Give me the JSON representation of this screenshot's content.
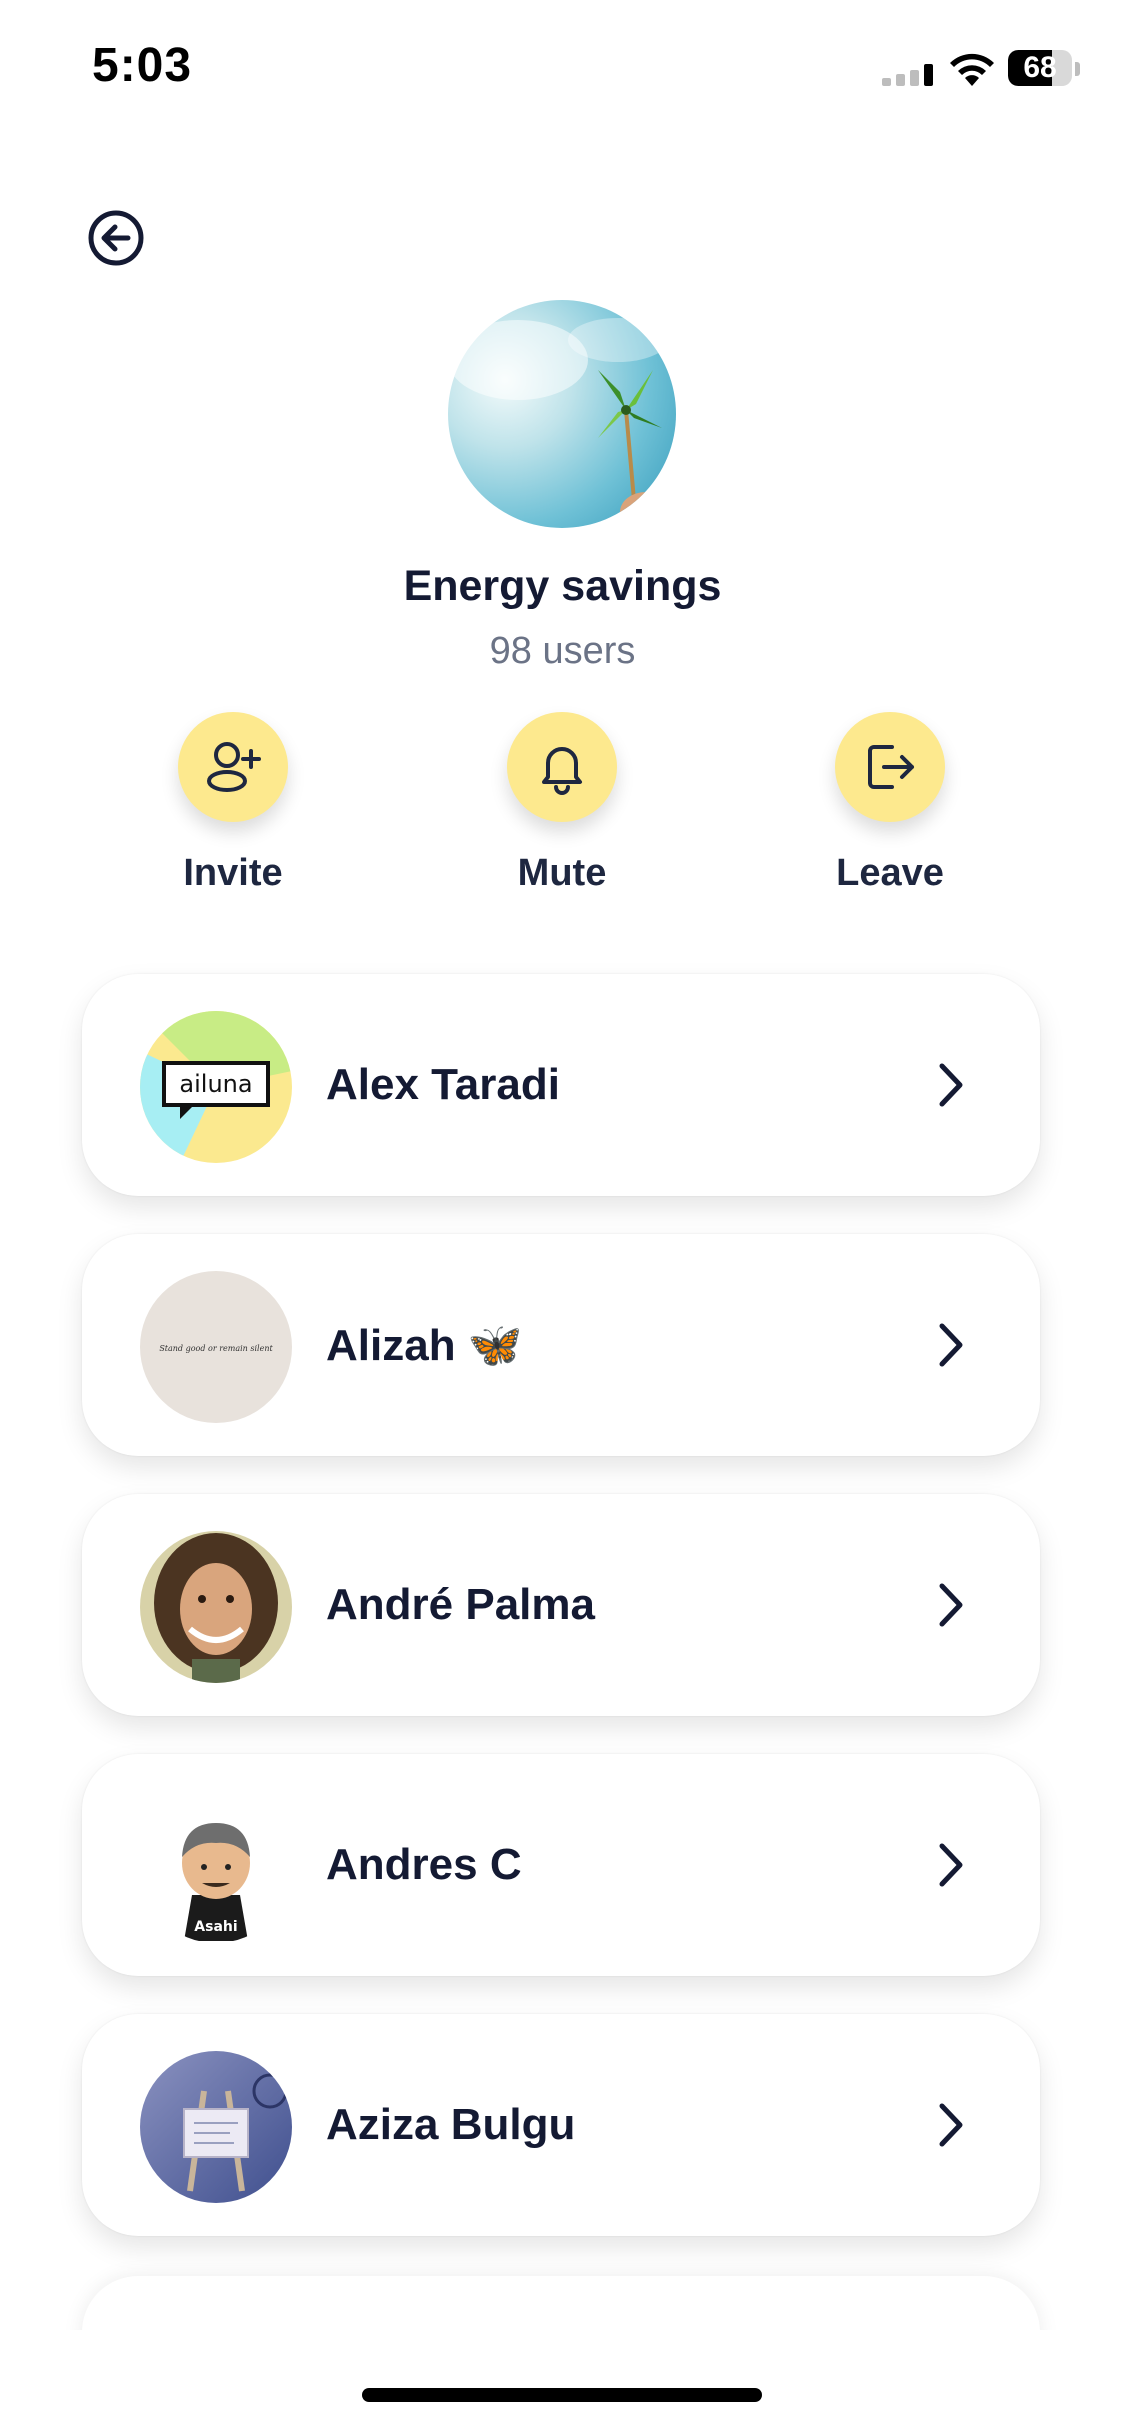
{
  "status_bar": {
    "time": "5:03",
    "battery_level": "68",
    "battery_fraction": 0.68
  },
  "group": {
    "name": "Energy savings",
    "user_count": "98 users"
  },
  "actions": [
    {
      "label": "Invite",
      "icon": "add-user-icon"
    },
    {
      "label": "Mute",
      "icon": "bell-icon"
    },
    {
      "label": "Leave",
      "icon": "logout-icon"
    }
  ],
  "members": [
    {
      "name": "Alex Taradi",
      "avatar_text": "ailuna"
    },
    {
      "name": "Alizah 🦋",
      "avatar_text": "Stand good or remain silent"
    },
    {
      "name": "André Palma"
    },
    {
      "name": "Andres C",
      "avatar_text": "Asahi"
    },
    {
      "name": "Aziza Bulgu"
    }
  ],
  "colors": {
    "accent_yellow": "#fde98e",
    "text_dark": "#141a33",
    "text_muted": "#6b7386"
  }
}
